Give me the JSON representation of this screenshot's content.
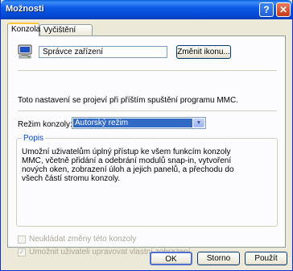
{
  "window": {
    "title": "Možnosti",
    "help_glyph": "?",
    "close_glyph": "✕"
  },
  "tabs": [
    {
      "label": "Konzola",
      "active": true
    },
    {
      "label": "Vyčištění disku",
      "active": false
    }
  ],
  "console": {
    "name": "Správce zařízení",
    "change_icon_label": "Změnit ikonu...",
    "icon": "computer-icon"
  },
  "info_text": "Toto nastavení se projeví při příštím spuštění programu MMC.",
  "mode": {
    "label": "Režim konzoly:",
    "value": "Autorský režim"
  },
  "description": {
    "legend": "Popis",
    "text": "Umožní uživatelům úplný přístup ke všem funkcím konzoly MMC, včetně přidání a odebrání modulů snap-in, vytvoření nových oken, zobrazení úloh a jejich panelů, a přechodu do všech částí stromu konzoly."
  },
  "options": {
    "dont_save": {
      "label": "Neukládat změny této konzoly",
      "checked": false,
      "enabled": false
    },
    "allow_custom_view": {
      "label": "Umožnit uživateli upravovat vlastní zobrazení",
      "checked": true,
      "enabled": false
    }
  },
  "buttons": {
    "ok": "OK",
    "cancel": "Storno",
    "apply": "Použít"
  }
}
